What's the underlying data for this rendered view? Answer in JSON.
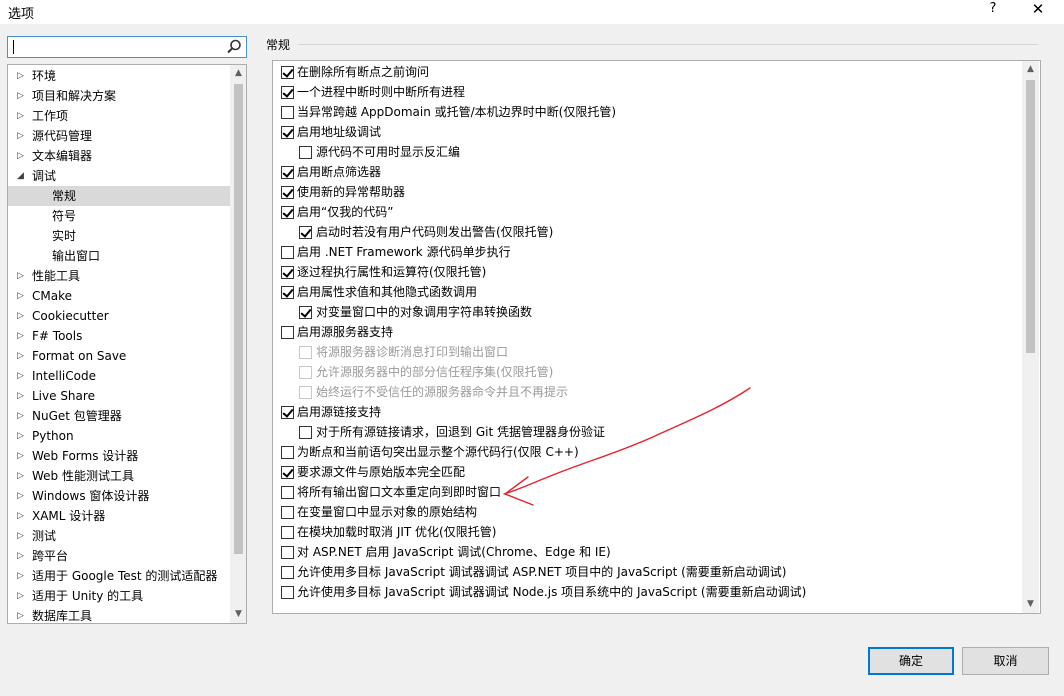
{
  "window": {
    "title": "选项",
    "help_label": "?",
    "close_label": "✕"
  },
  "search": {
    "value": "",
    "placeholder": ""
  },
  "tree": {
    "items": [
      {
        "label": "环境",
        "arrow": "▷",
        "level": 0
      },
      {
        "label": "项目和解决方案",
        "arrow": "▷",
        "level": 0
      },
      {
        "label": "工作项",
        "arrow": "▷",
        "level": 0
      },
      {
        "label": "源代码管理",
        "arrow": "▷",
        "level": 0
      },
      {
        "label": "文本编辑器",
        "arrow": "▷",
        "level": 0
      },
      {
        "label": "调试",
        "arrow": "◢",
        "level": 0,
        "expanded": true
      },
      {
        "label": "常规",
        "arrow": "",
        "level": 1,
        "selected": true
      },
      {
        "label": "符号",
        "arrow": "",
        "level": 1
      },
      {
        "label": "实时",
        "arrow": "",
        "level": 1
      },
      {
        "label": "输出窗口",
        "arrow": "",
        "level": 1
      },
      {
        "label": "性能工具",
        "arrow": "▷",
        "level": 0
      },
      {
        "label": "CMake",
        "arrow": "▷",
        "level": 0
      },
      {
        "label": "Cookiecutter",
        "arrow": "▷",
        "level": 0
      },
      {
        "label": "F# Tools",
        "arrow": "▷",
        "level": 0
      },
      {
        "label": "Format on Save",
        "arrow": "▷",
        "level": 0
      },
      {
        "label": "IntelliCode",
        "arrow": "▷",
        "level": 0
      },
      {
        "label": "Live Share",
        "arrow": "▷",
        "level": 0
      },
      {
        "label": "NuGet 包管理器",
        "arrow": "▷",
        "level": 0
      },
      {
        "label": "Python",
        "arrow": "▷",
        "level": 0
      },
      {
        "label": "Web Forms 设计器",
        "arrow": "▷",
        "level": 0
      },
      {
        "label": "Web 性能测试工具",
        "arrow": "▷",
        "level": 0
      },
      {
        "label": "Windows 窗体设计器",
        "arrow": "▷",
        "level": 0
      },
      {
        "label": "XAML 设计器",
        "arrow": "▷",
        "level": 0
      },
      {
        "label": "测试",
        "arrow": "▷",
        "level": 0
      },
      {
        "label": "跨平台",
        "arrow": "▷",
        "level": 0
      },
      {
        "label": "适用于 Google Test 的测试适配器",
        "arrow": "▷",
        "level": 0
      },
      {
        "label": "适用于 Unity 的工具",
        "arrow": "▷",
        "level": 0
      },
      {
        "label": "数据库工具",
        "arrow": "▷",
        "level": 0
      }
    ]
  },
  "section_title": "常规",
  "options": [
    {
      "label": "在删除所有断点之前询问",
      "checked": true,
      "level": 0,
      "enabled": true
    },
    {
      "label": "一个进程中断时则中断所有进程",
      "checked": true,
      "level": 0,
      "enabled": true
    },
    {
      "label": "当异常跨越 AppDomain 或托管/本机边界时中断(仅限托管)",
      "checked": false,
      "level": 0,
      "enabled": true
    },
    {
      "label": "启用地址级调试",
      "checked": true,
      "level": 0,
      "enabled": true
    },
    {
      "label": "源代码不可用时显示反汇编",
      "checked": false,
      "level": 1,
      "enabled": true
    },
    {
      "label": "启用断点筛选器",
      "checked": true,
      "level": 0,
      "enabled": true
    },
    {
      "label": "使用新的异常帮助器",
      "checked": true,
      "level": 0,
      "enabled": true
    },
    {
      "label": "启用“仅我的代码”",
      "checked": true,
      "level": 0,
      "enabled": true
    },
    {
      "label": "启动时若没有用户代码则发出警告(仅限托管)",
      "checked": true,
      "level": 1,
      "enabled": true
    },
    {
      "label": "启用 .NET Framework 源代码单步执行",
      "checked": false,
      "level": 0,
      "enabled": true
    },
    {
      "label": "逐过程执行属性和运算符(仅限托管)",
      "checked": true,
      "level": 0,
      "enabled": true
    },
    {
      "label": "启用属性求值和其他隐式函数调用",
      "checked": true,
      "level": 0,
      "enabled": true
    },
    {
      "label": "对变量窗口中的对象调用字符串转换函数",
      "checked": true,
      "level": 1,
      "enabled": true
    },
    {
      "label": "启用源服务器支持",
      "checked": false,
      "level": 0,
      "enabled": true
    },
    {
      "label": "将源服务器诊断消息打印到输出窗口",
      "checked": false,
      "level": 1,
      "enabled": false
    },
    {
      "label": "允许源服务器中的部分信任程序集(仅限托管)",
      "checked": false,
      "level": 1,
      "enabled": false
    },
    {
      "label": "始终运行不受信任的源服务器命令并且不再提示",
      "checked": false,
      "level": 1,
      "enabled": false
    },
    {
      "label": "启用源链接支持",
      "checked": true,
      "level": 0,
      "enabled": true
    },
    {
      "label": "对于所有源链接请求，回退到 Git 凭据管理器身份验证",
      "checked": false,
      "level": 1,
      "enabled": true
    },
    {
      "label": "为断点和当前语句突出显示整个源代码行(仅限 C++)",
      "checked": false,
      "level": 0,
      "enabled": true
    },
    {
      "label": "要求源文件与原始版本完全匹配",
      "checked": true,
      "level": 0,
      "enabled": true
    },
    {
      "label": "将所有输出窗口文本重定向到即时窗口",
      "checked": false,
      "level": 0,
      "enabled": true
    },
    {
      "label": "在变量窗口中显示对象的原始结构",
      "checked": false,
      "level": 0,
      "enabled": true
    },
    {
      "label": "在模块加载时取消 JIT 优化(仅限托管)",
      "checked": false,
      "level": 0,
      "enabled": true
    },
    {
      "label": "对 ASP.NET 启用 JavaScript 调试(Chrome、Edge 和 IE)",
      "checked": false,
      "level": 0,
      "enabled": true
    },
    {
      "label": "允许使用多目标 JavaScript 调试器调试 ASP.NET 项目中的 JavaScript (需要重新启动调试)",
      "checked": false,
      "level": 0,
      "enabled": true
    },
    {
      "label": "允许使用多目标 JavaScript 调试器调试 Node.js 项目系统中的 JavaScript (需要重新启动调试)",
      "checked": false,
      "level": 0,
      "enabled": true
    }
  ],
  "buttons": {
    "ok": "确定",
    "cancel": "取消"
  },
  "scroll_arrows": {
    "up": "▲",
    "down": "▼"
  },
  "colors": {
    "annotation": "#e8212b",
    "focus_border": "#0078d7"
  }
}
